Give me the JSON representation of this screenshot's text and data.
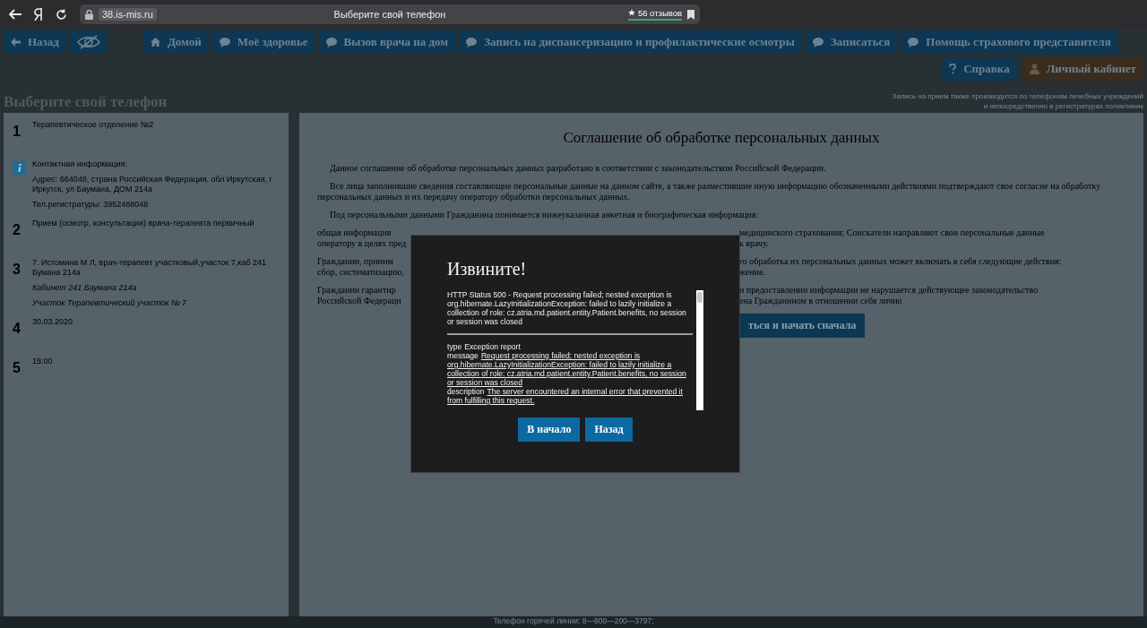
{
  "browser": {
    "url": "38.is-mis.ru",
    "tab_title": "Выберите свой телефон",
    "reviews": "56 отзывов"
  },
  "nav": [
    {
      "kind": "back",
      "label": "Назад"
    },
    {
      "kind": "eye"
    },
    {
      "kind": "home",
      "label": "Домой"
    },
    {
      "kind": "chat",
      "label": "Моё здоровье"
    },
    {
      "kind": "chat",
      "label": "Вызов врача на дом"
    },
    {
      "kind": "chat",
      "label": "Запись на диспансеризацию и профилактические осмотры"
    },
    {
      "kind": "chat",
      "label": "Записаться"
    },
    {
      "kind": "chat",
      "label": "Помощь страхового представителя"
    }
  ],
  "nav_secondary": [
    {
      "kind": "help",
      "label": "Справка"
    },
    {
      "kind": "account",
      "label": "Личный кабинет"
    }
  ],
  "page_title": "Выберите свой телефон",
  "note": [
    "Запись на прием также производится по телефонам лечебных учреждений",
    "и непосредственно в регистратурах поликлиник"
  ],
  "steps": [
    {
      "kind": "step",
      "marker": "1",
      "lines": [
        {
          "text": "Терапевтическое отделение №2",
          "italic": false
        }
      ]
    },
    {
      "kind": "info",
      "lines": [
        {
          "text": "Контактная информация:",
          "italic": false
        },
        {
          "text": "Адрес: 664048, страна Российская Федерация, обл Иркутская, г Иркутск, ул Баумана, ДОМ 214а",
          "italic": false
        },
        {
          "text": "Тел.регистратуры: 3952488048",
          "italic": false
        }
      ]
    },
    {
      "kind": "step",
      "marker": "2",
      "lines": [
        {
          "text": "Прием (осмотр, консультация) врача-терапевта первичный",
          "italic": false
        }
      ]
    },
    {
      "kind": "step",
      "marker": "3",
      "lines": [
        {
          "text": "7. Истомина М Л, врач-терапевт участковый,участок 7,каб 241 Бумана 214а",
          "italic": false
        },
        {
          "text": "Кабинет 241 Баумана 214а",
          "italic": true
        },
        {
          "text": "Участок Терапевтический участок № 7",
          "italic": true
        }
      ]
    },
    {
      "kind": "step",
      "marker": "4",
      "lines": [
        {
          "text": "30.03.2020",
          "italic": false
        }
      ]
    },
    {
      "kind": "step",
      "marker": "5",
      "lines": [
        {
          "text": "15:00",
          "italic": false
        }
      ]
    }
  ],
  "agreement": {
    "title": "Соглашение об обработке персональных данных",
    "paragraphs": [
      "Данное соглашение об обработке персональных данных разработано в соответствии с законодательством Российской Федерации.",
      "Все лица заполнившие сведения составляющие персональные данные на данном сайте, а также разместившие иную информацию обозначенными действиями подтверждают свое согласие на обработку персональных данных и их передачу оператору обработки персональных данных.",
      "Под персональными данными Гражданина понимается нижеуказанная анкетная и биографическая информация:"
    ],
    "covered_paragraphs": [
      [
        {
          "left": "общая информация",
          "right": "медицинского страхования; Соискатели направляют свои персональные данные"
        },
        {
          "left": "оператору в целях пред",
          "right": "к врачу."
        }
      ],
      [
        {
          "left": "Гражданин, приним",
          "right": "го обработка их персональных данных может включать в себя следующие действия:"
        },
        {
          "left": "сбор, систематизацию,",
          "right": "жение."
        }
      ],
      [
        {
          "left": "Гражданин гарантир",
          "right": "и предоставлении информации не нарушается действующее законодательство"
        },
        {
          "left": "Российской Федераци",
          "right": "ена Гражданином в отношении себя лично"
        }
      ]
    ],
    "button_visible_part": "ться и начать сначала"
  },
  "dialog": {
    "title": "Извините!",
    "status": "HTTP Status 500 - Request processing failed; nested exception is org.hibernate.LazyInitializationException: failed to lazily initialize a collection of role: cz.atria.md.patient.entity.Patient.benefits, no session or session was closed",
    "report": [
      {
        "label": "type",
        "text": "Exception report",
        "underlined": false
      },
      {
        "label": "message",
        "text": "Request processing failed; nested exception is org.hibernate.LazyInitializationException: failed to lazily initialize a collection of role: cz.atria.md.patient.entity.Patient.benefits, no session or session was closed",
        "underlined": true
      },
      {
        "label": "description",
        "text": "The server encountered an internal error that prevented it from fulfilling this request.",
        "underlined": true
      }
    ],
    "buttons": [
      "В начало",
      "Назад"
    ]
  },
  "footer": "Телефон горячей линии: 8—800—200—3797;"
}
